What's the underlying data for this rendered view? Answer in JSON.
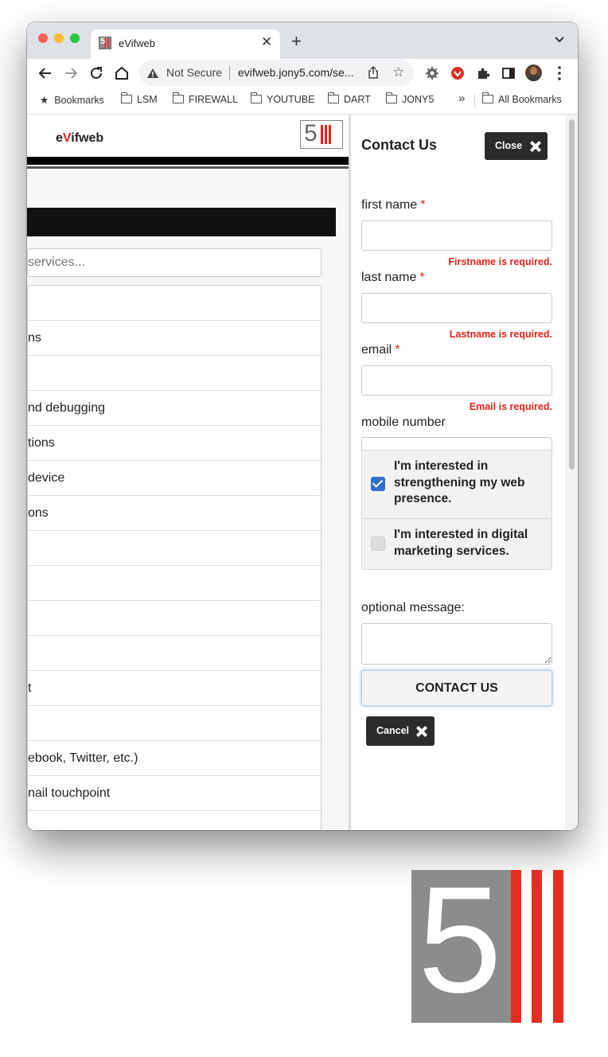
{
  "browser": {
    "tab_title": "eVifweb",
    "tab_favicon_text": "5",
    "security_label": "Not Secure",
    "url": "evifweb.jony5.com/se...",
    "bookmarks": [
      "Bookmarks",
      "LSM",
      "FIREWALL",
      "YOUTUBE",
      "DART",
      "JONY5"
    ],
    "overflow_label": "»",
    "all_bookmarks": "All Bookmarks"
  },
  "site": {
    "brand_pre": "e",
    "brand_v": "V",
    "brand_post": "ifweb",
    "logo_text": "5",
    "search_placeholder": "services...",
    "services": [
      "",
      "ns",
      "",
      "nd debugging",
      "tions",
      " device",
      "ons",
      "",
      "",
      "",
      "",
      "t",
      "",
      "ebook, Twitter, etc.)",
      "nail touchpoint",
      ""
    ]
  },
  "contact": {
    "title": "Contact Us",
    "close_label": "Close",
    "first_name_label": "first name",
    "first_name_value": "",
    "first_name_error": "Firstname is required.",
    "last_name_label": "last name",
    "last_name_value": "",
    "last_name_error": "Lastname is required.",
    "email_label": "email",
    "email_value": "",
    "email_error": "Email is required.",
    "mobile_label": "mobile number",
    "mobile_value": "",
    "required_mark": "*",
    "option_web": "I'm interested in strengthening my web presence.",
    "option_web_checked": true,
    "option_marketing": "I'm interested in digital marketing services.",
    "option_marketing_checked": false,
    "message_label": "optional message:",
    "message_value": "",
    "submit_label": "CONTACT US",
    "cancel_label": "Cancel"
  },
  "colors": {
    "accent_red": "#e2231a",
    "checkbox_blue": "#2f6fd1",
    "button_dark": "#2b2b2b"
  },
  "footer_logo": {
    "text": "5"
  }
}
